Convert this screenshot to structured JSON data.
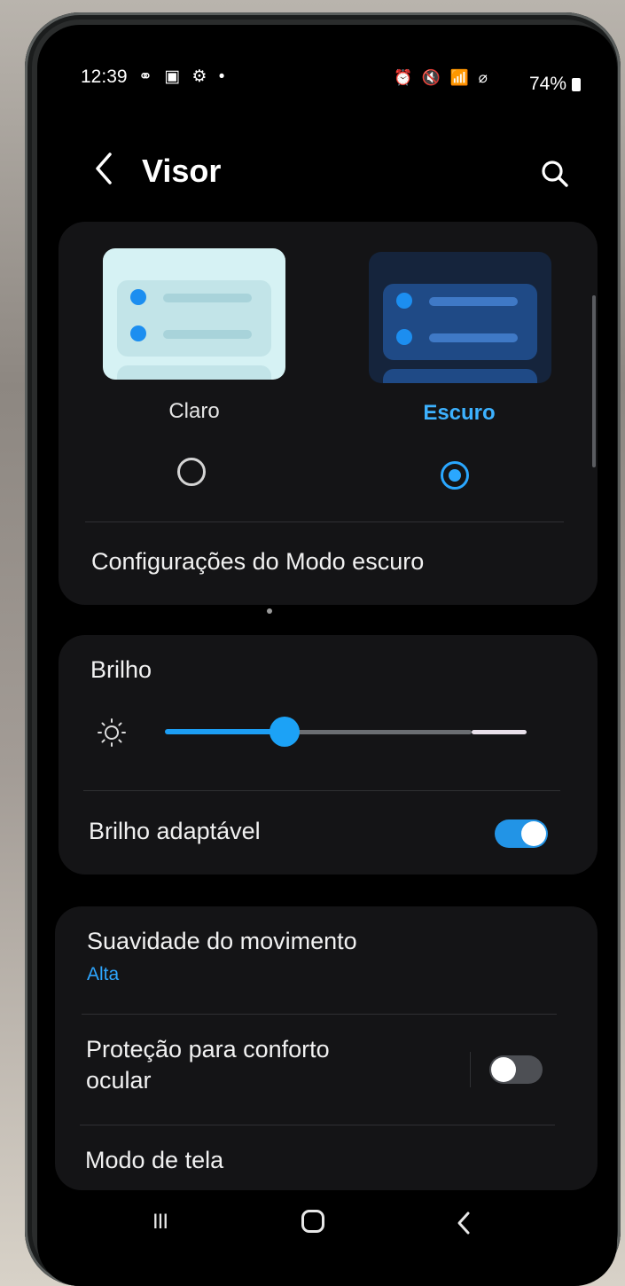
{
  "status_bar": {
    "time": "12:39",
    "left_icons": "⚭ ▣ ⚙ •",
    "right_icons": "⏰ 🔇 📶 ⌀",
    "battery": "74%"
  },
  "header": {
    "title": "Visor"
  },
  "theme": {
    "light_label": "Claro",
    "dark_label": "Escuro",
    "selected": "Escuro",
    "accent_color": "#2aa7ff"
  },
  "dark_mode_settings_label": "Configurações do Modo escuro",
  "brightness": {
    "label": "Brilho",
    "level": 0.33,
    "adaptive_label": "Brilho adaptável",
    "adaptive_on": true
  },
  "motion": {
    "label": "Suavidade do movimento",
    "value": "Alta"
  },
  "eye_comfort": {
    "label_line1": "Proteção para conforto",
    "label_line2": "ocular",
    "on": false
  },
  "screen_mode_label": "Modo de tela",
  "nav": {
    "recent_glyph": "III"
  },
  "icons": [
    "back-icon",
    "search-icon",
    "sun-icon",
    "radio-icon",
    "toggle-icon",
    "recent-apps-icon",
    "home-icon",
    "nav-back-icon"
  ]
}
